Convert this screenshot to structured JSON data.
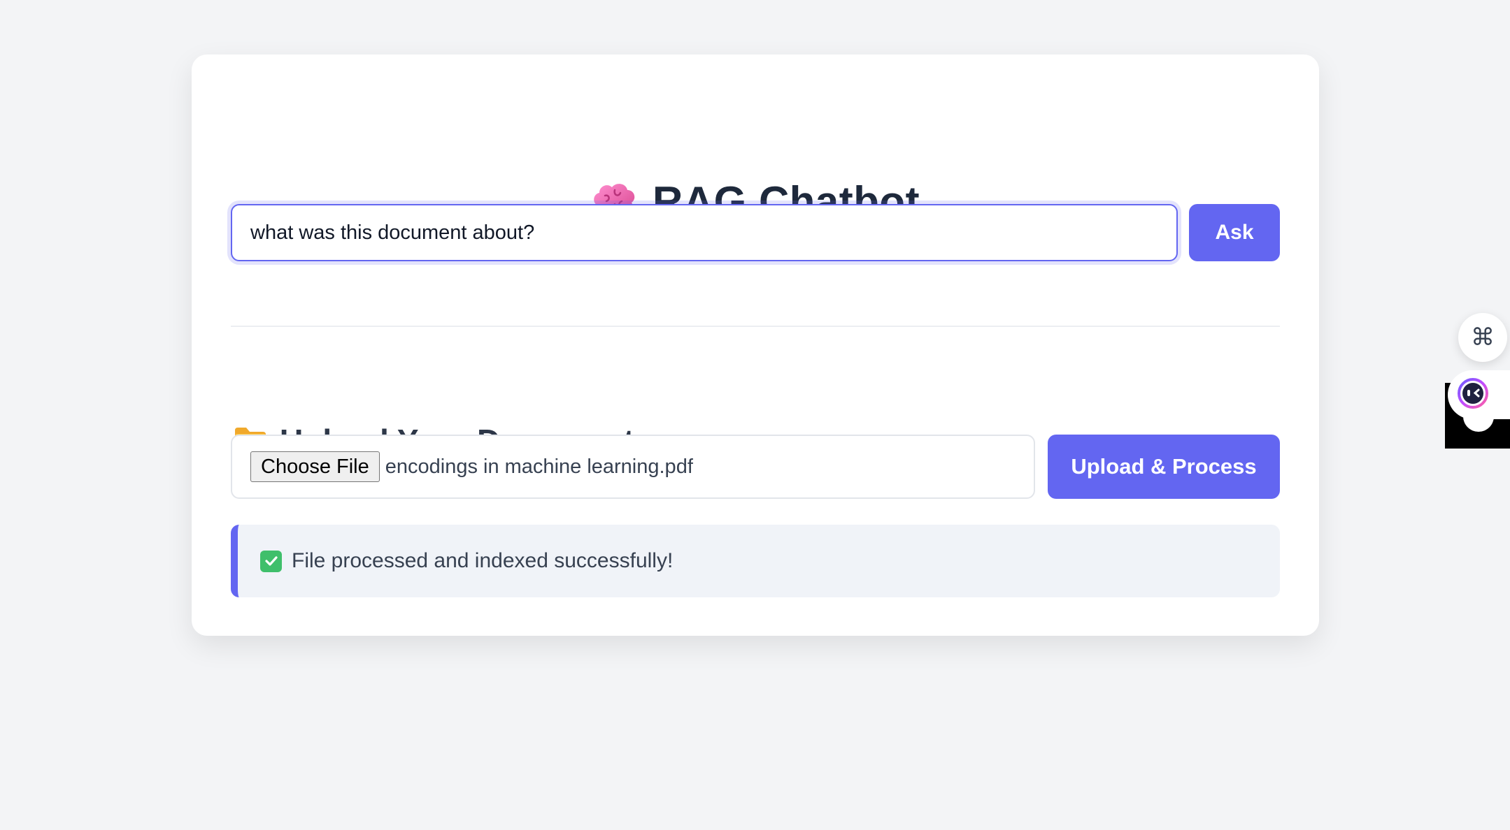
{
  "header": {
    "title": "RAG Chatbot",
    "icon": "brain-icon"
  },
  "chat": {
    "query_value": "what was this document about?",
    "ask_label": "Ask"
  },
  "upload": {
    "heading": "Upload Your Document",
    "heading_icon": "folder-icon",
    "choose_file_label": "Choose File",
    "file_name": "encodings in machine learning.pdf",
    "upload_label": "Upload & Process"
  },
  "status": {
    "icon": "check-icon",
    "message": "File processed and indexed successfully!"
  },
  "side_widgets": {
    "command_icon": "⌘",
    "assistant_icon": "assistant-face-icon"
  },
  "colors": {
    "accent": "#6366f1",
    "page_background": "#f3f4f6",
    "card_background": "#ffffff",
    "status_background": "#f0f3f8",
    "success": "#3fbf6b"
  }
}
